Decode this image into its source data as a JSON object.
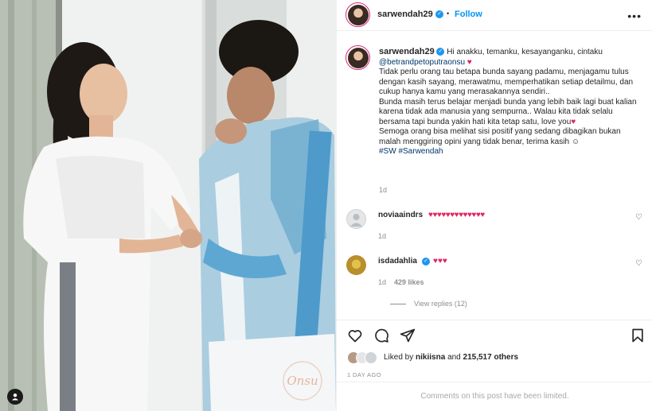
{
  "post": {
    "author": "sarwendah29",
    "verified_icon": "verified-badge-icon",
    "follow_label": "Follow",
    "separator": "•",
    "more_icon": "more-options-icon"
  },
  "caption": {
    "author": "sarwendah29",
    "line_greeting": "Hi anakku, temanku, kesayanganku, cintaku",
    "mention": "@betrandpetoputraonsu",
    "paragraph1": "Tidak perlu orang tau betapa bunda sayang padamu, menjagamu tulus dengan kasih sayang, merawatmu, memperhatikan setiap detailmu, dan cukup hanya kamu yang merasakannya sendiri..",
    "paragraph2": "Bunda masih terus belajar menjadi bunda yang lebih baik lagi buat kalian karena tidak ada manusia yang sempurna.. Walau kita tidak selalu bersama tapi bunda yakin hati kita tetap satu, love you",
    "paragraph3": "Semoga orang bisa melihat sisi positif yang sedang dibagikan bukan malah menggiring opini yang tidak benar, terima kasih",
    "hashtags": "#SW #Sarwendah",
    "time": "1d",
    "heart": "♥",
    "smile": "☺"
  },
  "comments": [
    {
      "user": "noviaaindrs",
      "text": "♥♥♥♥♥♥♥♥♥♥♥♥♥",
      "time": "1d",
      "likes": ""
    },
    {
      "user": "isdadahlia",
      "text": "♥♥♥",
      "time": "1d",
      "likes": "429 likes",
      "replies": "View replies (12)"
    }
  ],
  "likes": {
    "label_prefix": "Liked by",
    "user": "nikiisna",
    "label_mid": "and",
    "count": "215,517 others"
  },
  "posted_ago": "1 DAY AGO",
  "comments_limited": "Comments on this post have been limited.",
  "watermark": "Onsu",
  "colors": {
    "accent": "#0095f6",
    "verified": "#1e96f0",
    "heart": "#e0245e",
    "muted": "#8e8e8e"
  }
}
